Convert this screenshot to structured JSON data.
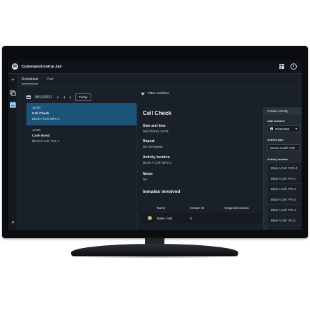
{
  "app": {
    "title": "CommandCentral Jail"
  },
  "rail": {
    "add_glyph": "+",
    "expand_glyph": "»"
  },
  "tabs": [
    {
      "label": "Scheduled",
      "active": true
    },
    {
      "label": "Past",
      "active": false
    }
  ],
  "toolbar": {
    "date": "05/13/2021",
    "today_label": "Today",
    "filter_label": "Filter Activities"
  },
  "schedule": [
    {
      "time": "12:00",
      "title": "Cell Check",
      "location": "Block A Cell: MP2-1",
      "selected": true
    },
    {
      "time": "14:00",
      "title": "Cash Bond",
      "location": "Block B Cell: FP1-4",
      "selected": false
    }
  ],
  "detail": {
    "title": "Cell Check",
    "date_label": "Date and time",
    "date_value": "05/13/2021 12:00",
    "repeat_label": "Repeat",
    "repeat_value": "Do not repeat",
    "location_label": "Activity location",
    "location_value": "Block A Cell: MP2-1",
    "notes_label": "Notes",
    "notes_value": "NA"
  },
  "inmates": {
    "title": "Inmates involved",
    "headers": [
      "Name",
      "Inmate ID",
      "Assigned location"
    ],
    "rows": [
      {
        "name": "Baker, Neil",
        "id": "5",
        "location": ""
      }
    ]
  },
  "create_panel": {
    "title": "Create Activity",
    "date_label": "Date and time",
    "date_value": "05/28/2021",
    "type_label": "Activity type",
    "type_value": "Mental Health Visit",
    "location_label": "Activity location",
    "location_options": [
      "Block A Cell: FJP1-1",
      "Block A Cell: FP1-1",
      "Block A Cell: FP1-2",
      "Block A Cell: FP1-3",
      "Block A Cell: FP1-4",
      "Block A Cell: JP1-3"
    ]
  }
}
